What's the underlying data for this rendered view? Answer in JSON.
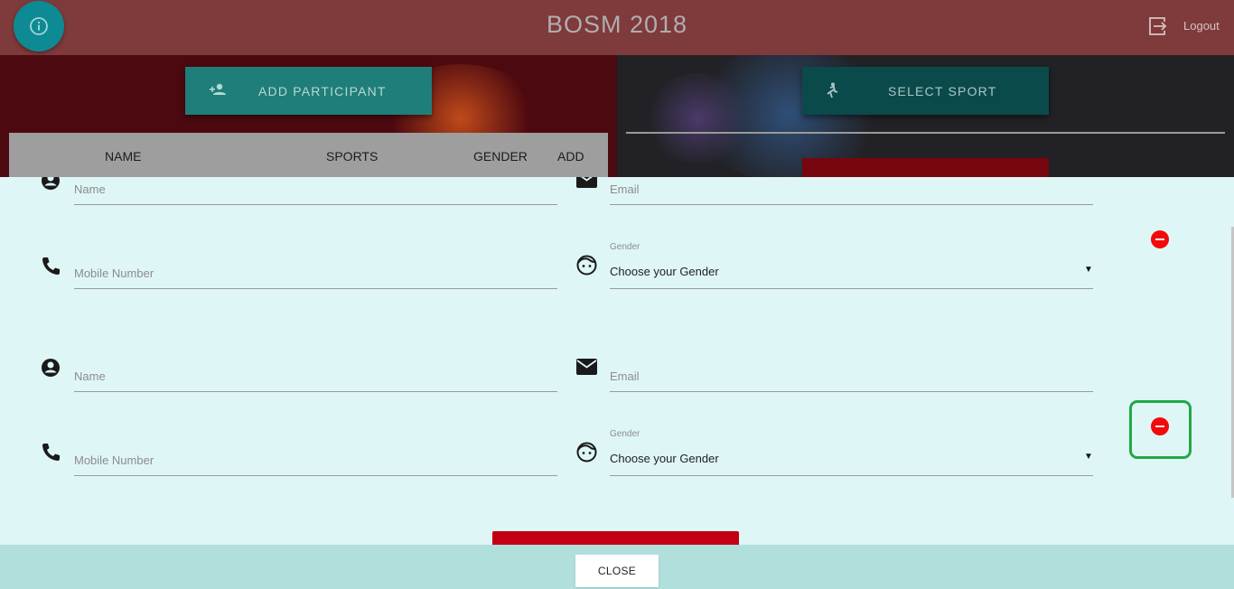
{
  "header": {
    "title": "BOSM 2018",
    "logout_label": "Logout"
  },
  "actions": {
    "add_participant": "ADD PARTICIPANT",
    "select_sport": "SELECT SPORT"
  },
  "table": {
    "columns": [
      "NAME",
      "SPORTS",
      "GENDER",
      "ADD"
    ]
  },
  "form": {
    "entries": [
      {
        "name_placeholder": "Name",
        "email_placeholder": "Email",
        "mobile_placeholder": "Mobile Number",
        "gender_label": "Gender",
        "gender_value": "Choose your Gender"
      },
      {
        "name_placeholder": "Name",
        "email_placeholder": "Email",
        "mobile_placeholder": "Mobile Number",
        "gender_label": "Gender",
        "gender_value": "Choose your Gender"
      }
    ]
  },
  "footer": {
    "close_label": "CLOSE"
  },
  "colors": {
    "header": "#7f3a3b",
    "modal_bg": "#dff6f7",
    "remove": "#f30a0a",
    "highlight": "#22a845",
    "footer": "#b1dfdb"
  },
  "icons": [
    "info-icon",
    "logout-icon",
    "add-person-icon",
    "runner-icon",
    "account-icon",
    "email-icon",
    "phone-icon",
    "face-icon",
    "remove-icon"
  ]
}
